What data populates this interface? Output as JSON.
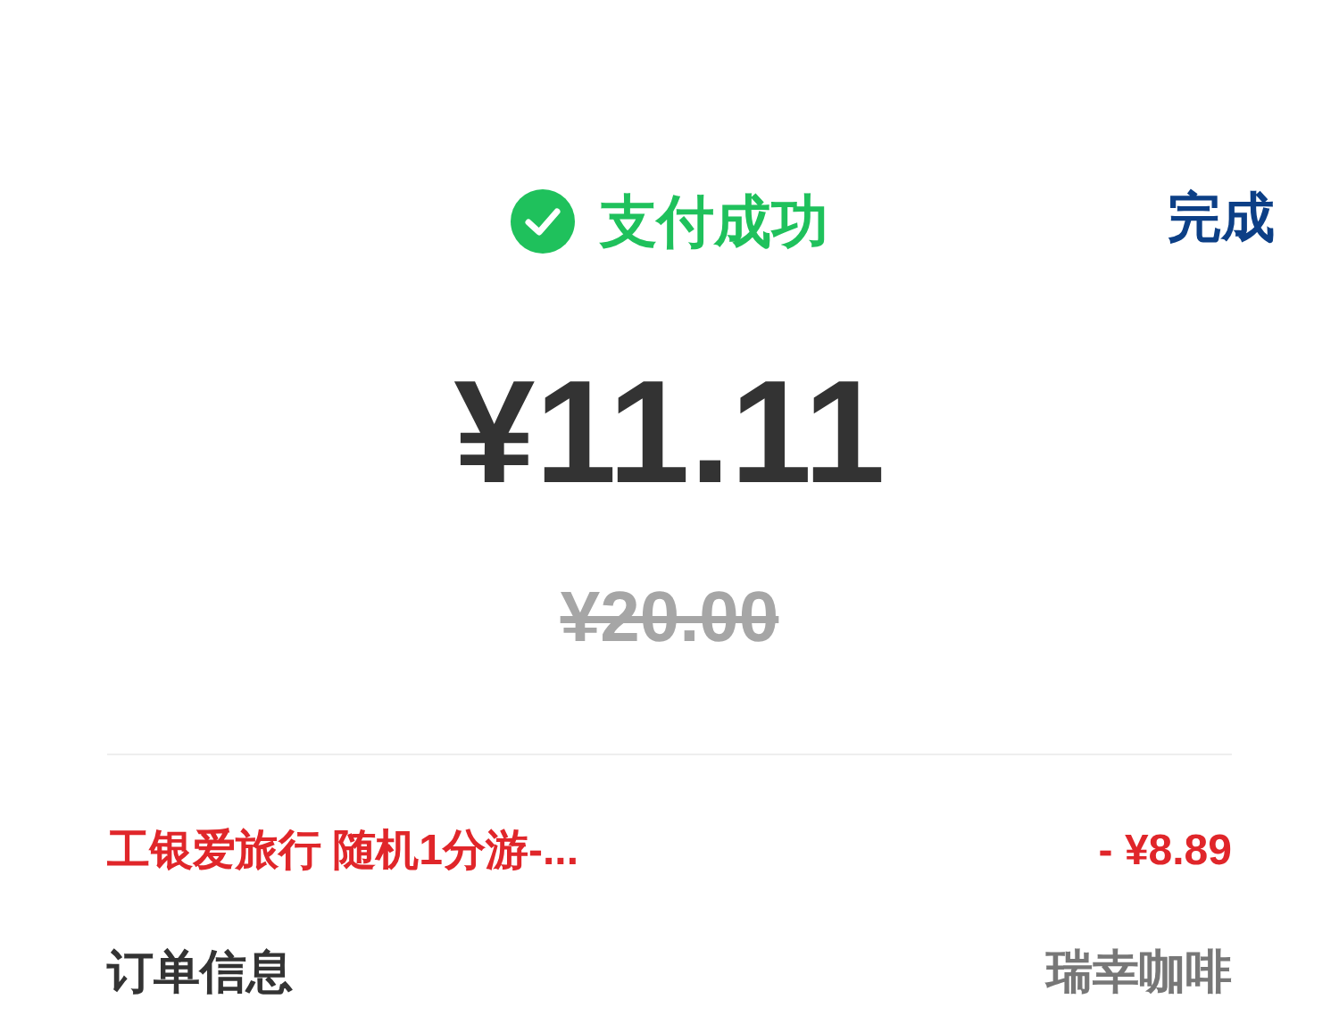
{
  "header": {
    "status": "支付成功",
    "done": "完成"
  },
  "amount": {
    "paid": "¥11.11",
    "original": "¥20.00"
  },
  "discounts": [
    {
      "label": "工银爱旅行 随机1分游-...",
      "value": "- ¥8.89"
    }
  ],
  "order": {
    "label": "订单信息",
    "merchant": "瑞幸咖啡"
  }
}
